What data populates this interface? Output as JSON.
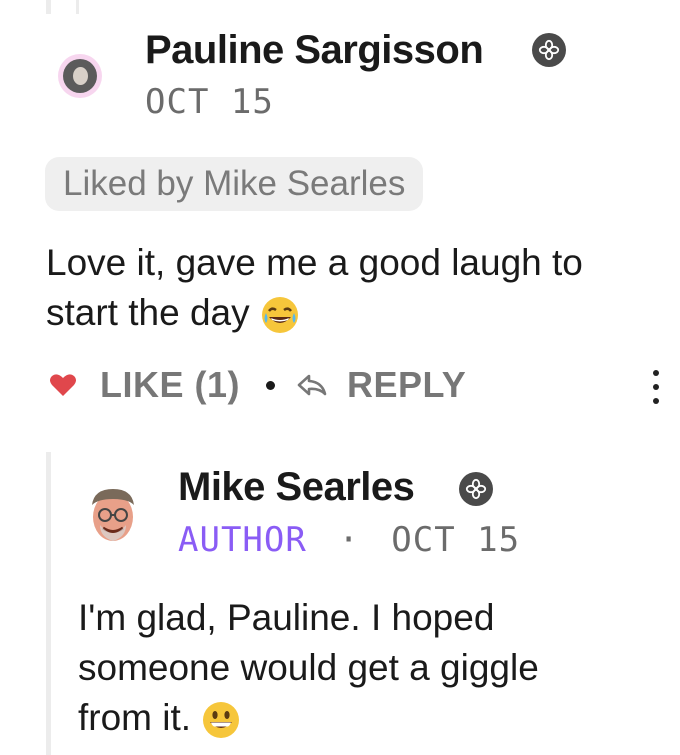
{
  "comment": {
    "author": "Pauline Sargisson",
    "date": "OCT 15",
    "liked_by": "Liked by Mike Searles",
    "text": "Love it, gave me a good laugh to start the day",
    "text_line1": "Love it, gave me a good laugh to",
    "text_line2": "start the day",
    "like_label": "LIKE (1)",
    "reply_label": "REPLY",
    "badge_icon": "flower-badge-icon"
  },
  "reply": {
    "author": "Mike Searles",
    "role": "AUTHOR",
    "separator": "·",
    "date": "OCT 15",
    "text_line1": "I'm glad, Pauline. I hoped",
    "text_line2": "someone would get a giggle",
    "text_line3": "from it.",
    "badge_icon": "flower-badge-icon"
  },
  "colors": {
    "heart": "#e0474c",
    "author_role": "#8a5cf5",
    "pill_bg": "#efefef",
    "muted": "#777777"
  }
}
